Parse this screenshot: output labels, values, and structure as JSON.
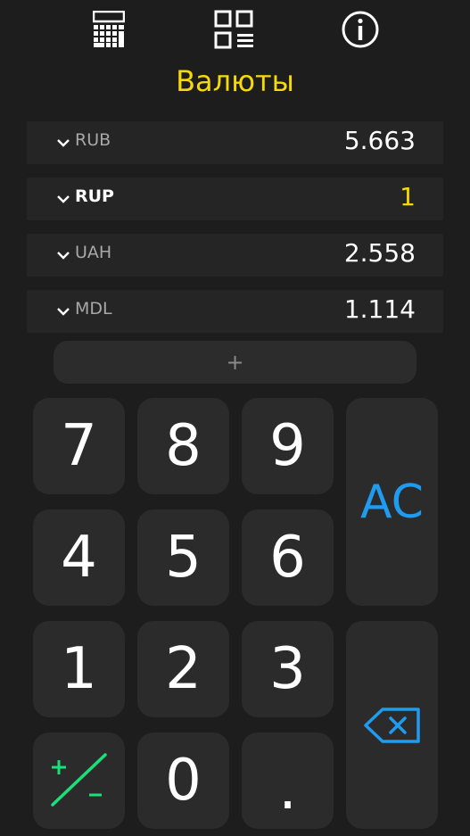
{
  "header": {
    "title": "Валюты"
  },
  "toolbar": {
    "buttons": [
      {
        "icon": "calculator-icon"
      },
      {
        "icon": "grid-list-icon"
      },
      {
        "icon": "info-icon"
      }
    ]
  },
  "currencies": [
    {
      "code": "RUB",
      "value": "5.663",
      "active": false
    },
    {
      "code": "RUP",
      "value": "1",
      "active": true
    },
    {
      "code": "UAH",
      "value": "2.558",
      "active": false
    },
    {
      "code": "MDL",
      "value": "1.114",
      "active": false
    }
  ],
  "add_button": {
    "label": "+"
  },
  "keypad": {
    "k7": "7",
    "k8": "8",
    "k9": "9",
    "k4": "4",
    "k5": "5",
    "k6": "6",
    "k1": "1",
    "k2": "2",
    "k3": "3",
    "k0": "0",
    "dot": ".",
    "clear": "AC",
    "backspace_icon": "backspace-icon",
    "sign_icon": "plus-minus-icon"
  },
  "colors": {
    "accent_yellow": "#f5d90a",
    "accent_blue": "#1f9bf0",
    "accent_green": "#19e07a",
    "background": "#1d1d1d"
  }
}
